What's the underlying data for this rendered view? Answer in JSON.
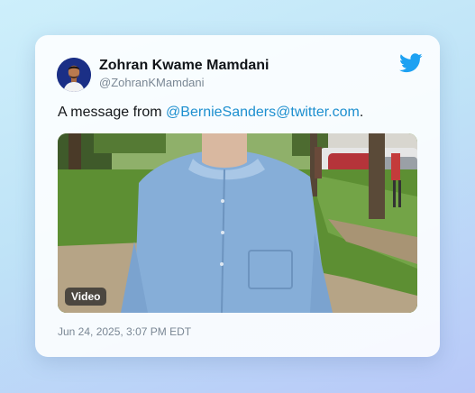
{
  "tweet": {
    "author_name": "Zohran Kwame Mamdani",
    "author_handle": "@ZohranKMamdani",
    "text_prefix": "A message from ",
    "mention": "@BernieSanders@twitter.com",
    "text_suffix": ".",
    "media_badge": "Video",
    "timestamp": "Jun 24, 2025, 3:07 PM EDT"
  },
  "icons": {
    "brand": "twitter-bird-icon",
    "avatar": "user-avatar"
  },
  "colors": {
    "twitter_blue": "#1da1f2",
    "mention_link": "#1d8fcf",
    "avatar_bg": "#1b2f86"
  }
}
